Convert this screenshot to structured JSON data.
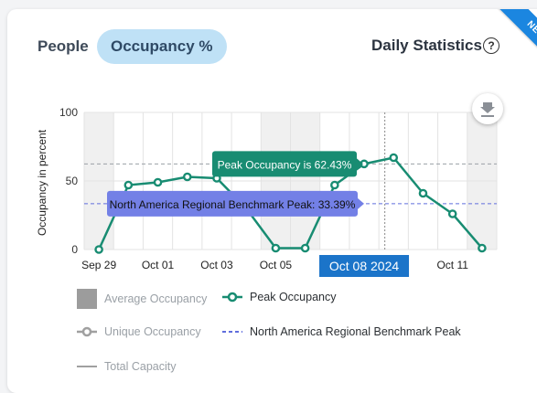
{
  "tabs": [
    {
      "label": "People",
      "active": false
    },
    {
      "label": "Occupancy %",
      "active": true
    }
  ],
  "header": {
    "title": "Daily Statistics",
    "help_icon": "help-circle-icon",
    "badge": "NEW"
  },
  "download_icon": "download-icon",
  "colors": {
    "accent": "#188c72",
    "benchmark": "#5f6ddd",
    "date_highlight": "#1b74c9",
    "active_tab_bg": "#bfe1f6"
  },
  "chart_data": {
    "type": "line",
    "ylabel": "Occupancy in percent",
    "ylim": [
      0,
      100
    ],
    "yticks": [
      "100",
      "50",
      "0"
    ],
    "x_tick_labels": [
      "Sep 29",
      "Oct 01",
      "Oct 03",
      "Oct 05",
      "Oct 08 2024",
      "Oct 11"
    ],
    "dates": [
      "Sep 29",
      "Sep 30",
      "Oct 01",
      "Oct 02",
      "Oct 03",
      "Oct 04",
      "Oct 05",
      "Oct 06",
      "Oct 07",
      "Oct 08",
      "Oct 09",
      "Oct 10",
      "Oct 11",
      "Oct 12"
    ],
    "series": [
      {
        "name": "Peak Occupancy",
        "color": "#188c72",
        "values": [
          0,
          47,
          49,
          53,
          52,
          30,
          1,
          1,
          47,
          62.43,
          67,
          41,
          26,
          1
        ]
      }
    ],
    "reference_lines": [
      {
        "name": "Peak Occupancy",
        "value": 62.43,
        "color": "#9aa0a6"
      },
      {
        "name": "North America Regional Benchmark Peak",
        "value": 33.39,
        "color": "#5f6ddd"
      }
    ],
    "tooltips": {
      "peak": "Peak Occupancy is 62.43%",
      "benchmark": "North America Regional Benchmark Peak: 33.39%"
    },
    "highlighted_date": "Oct 08 2024",
    "legend": [
      {
        "label": "Average Occupancy",
        "active": false,
        "kind": "box"
      },
      {
        "label": "Peak Occupancy",
        "active": true,
        "kind": "line-marker"
      },
      {
        "label": "Unique Occupancy",
        "active": false,
        "kind": "line-marker"
      },
      {
        "label": "North America Regional Benchmark Peak",
        "active": true,
        "kind": "dashed"
      },
      {
        "label": "Total Capacity",
        "active": false,
        "kind": "line"
      }
    ]
  }
}
